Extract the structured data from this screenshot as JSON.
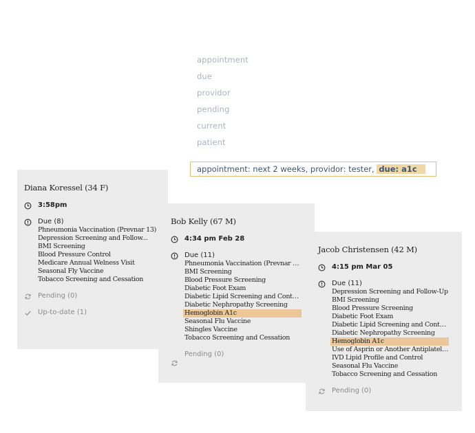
{
  "suggestions": [
    "appointment",
    "due",
    "providor",
    "pending",
    "current",
    "patient"
  ],
  "search": {
    "query_text": "appointment: next 2 weeks, providor: tester, ",
    "chip": "due: a1c"
  },
  "colors": {
    "highlight": "#ecc79a",
    "card_bg": "#ececec",
    "search_border": "#e8c074"
  },
  "cards": [
    {
      "title": "Diana Koressel (34 F)",
      "time": "3:58pm",
      "due_label": "Due (8)",
      "items": [
        "Phneumonia Vaccination (Prevnar 13)",
        "Depression Screening and Follow...",
        "BMI Screening",
        "Blood Pressure Control",
        "Medicare Annual Welness Visit",
        "Seasonal Fly Vaccine",
        "Tobacco Screening and Cessation"
      ],
      "pending": "Pending (0)",
      "uptodate": "Up-to-date (1)"
    },
    {
      "title": "Bob Kelly (67 M)",
      "time": "4:34 pm Feb 28",
      "due_label": "Due (11)",
      "items": [
        "Phneumonia Vaccination (Prevnar 13)",
        "BMI Screening",
        "Blood Pressure Screening",
        "Diabetic Foot Exam",
        "Diabetic Lipid Screening and Control...",
        "Diabetic Nephropathy Screening",
        "Hemoglobin A1c",
        "Seasonal Flu Vaccine",
        "Shingles Vaccine",
        "Tobacco Screening and Cessation"
      ],
      "highlighted_item": "Hemoglobin A1c",
      "pending": "Pending (0)"
    },
    {
      "title": "Jacob Christensen (42 M)",
      "time": "4:15 pm Mar 05",
      "due_label": "Due (11)",
      "items": [
        "Depression Screening and Follow-Up",
        "BMI Screening",
        "Blood Pressure Screening",
        "Diabetic Foot Exam",
        "Diabetic Lipid Screening and Control...",
        "Diabetic Nephropathy Screening",
        "Hemoglobin A1c",
        "Use of Asprin or Another Antiplatelet...",
        "IVD Lipid Profile and Control",
        "Seasonal Flu Vaccine",
        "Tobacco Screening and Cessation"
      ],
      "highlighted_item": "Hemoglobin A1c",
      "pending": "Pending (0)"
    }
  ]
}
